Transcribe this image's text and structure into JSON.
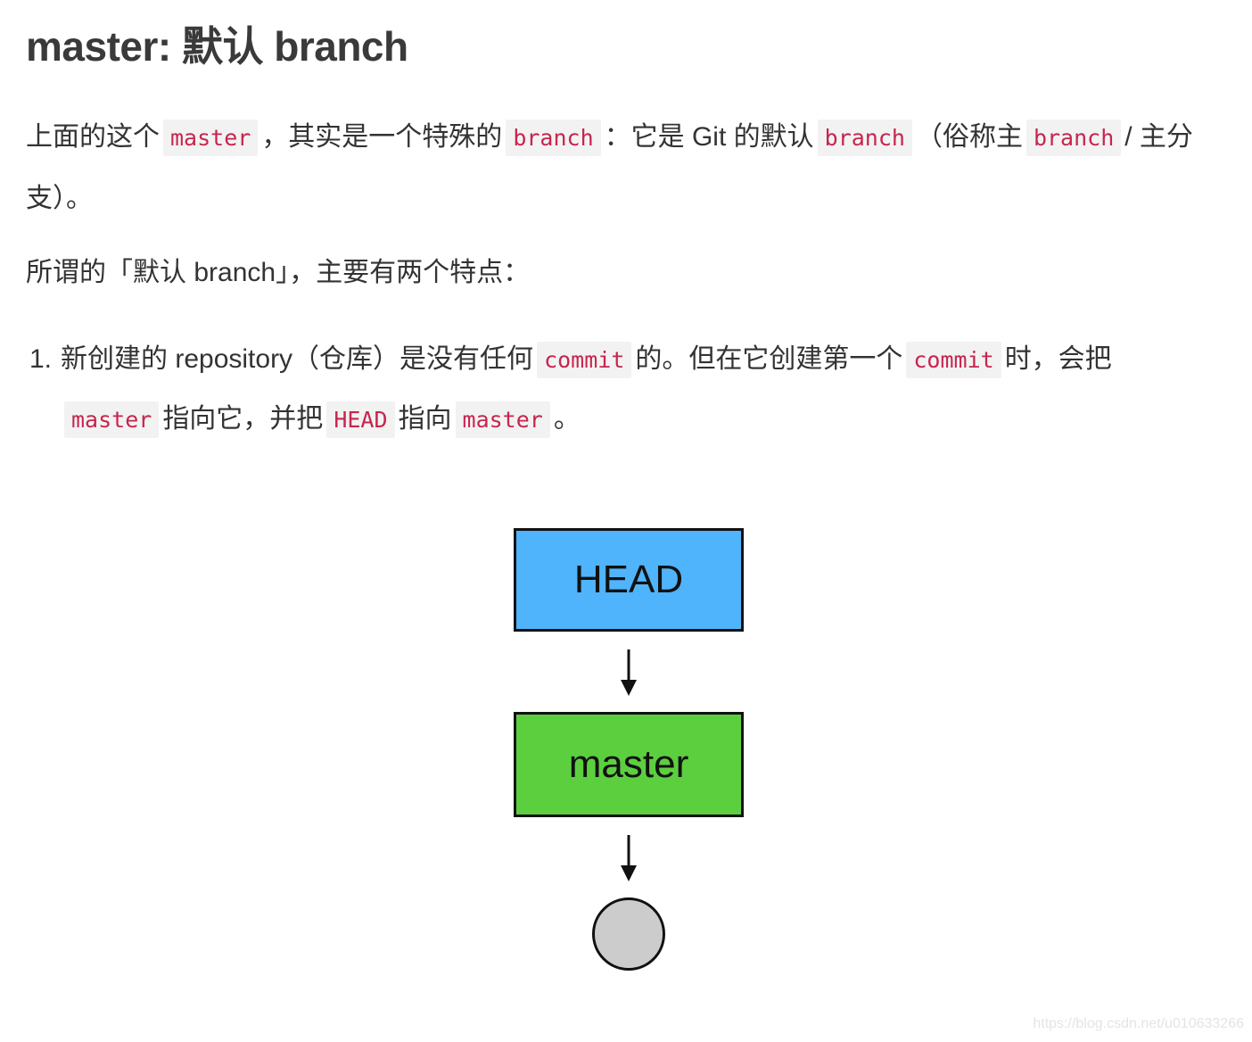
{
  "heading": "master: 默认 branch",
  "paragraph1": {
    "t1": "上面的这个",
    "c1": "master",
    "t2": "，其实是一个特殊的",
    "c2": "branch",
    "t3": "：它是 Git 的默认",
    "c3": "branch",
    "t4": "（俗称主",
    "c4": "branch",
    "t5": "/ 主分支）。"
  },
  "paragraph2": "所谓的「默认 branch」，主要有两个特点：",
  "list": [
    {
      "number": "1.",
      "t1": "新创建的 repository（仓库）是没有任何",
      "c1": "commit",
      "t2": "的。但在它创建第一个",
      "c2": "commit",
      "t3": "时，会把",
      "c3": "master",
      "t4": "指向它，并把",
      "c4": "HEAD",
      "t5": "指向",
      "c5": "master",
      "t6": "。"
    }
  ],
  "diagram": {
    "nodes": [
      {
        "id": "head",
        "label": "HEAD",
        "color": "#4fb4fb"
      },
      {
        "id": "master",
        "label": "master",
        "color": "#5ccf3f"
      },
      {
        "id": "commit",
        "label": "",
        "color": "#cccccc"
      }
    ],
    "edges": [
      {
        "from": "head",
        "to": "master"
      },
      {
        "from": "master",
        "to": "commit"
      }
    ]
  },
  "watermark": "https://blog.csdn.net/u010633266",
  "colors": {
    "code_text": "#c7254e",
    "code_bg": "#f2f2f2",
    "text": "#333333"
  }
}
